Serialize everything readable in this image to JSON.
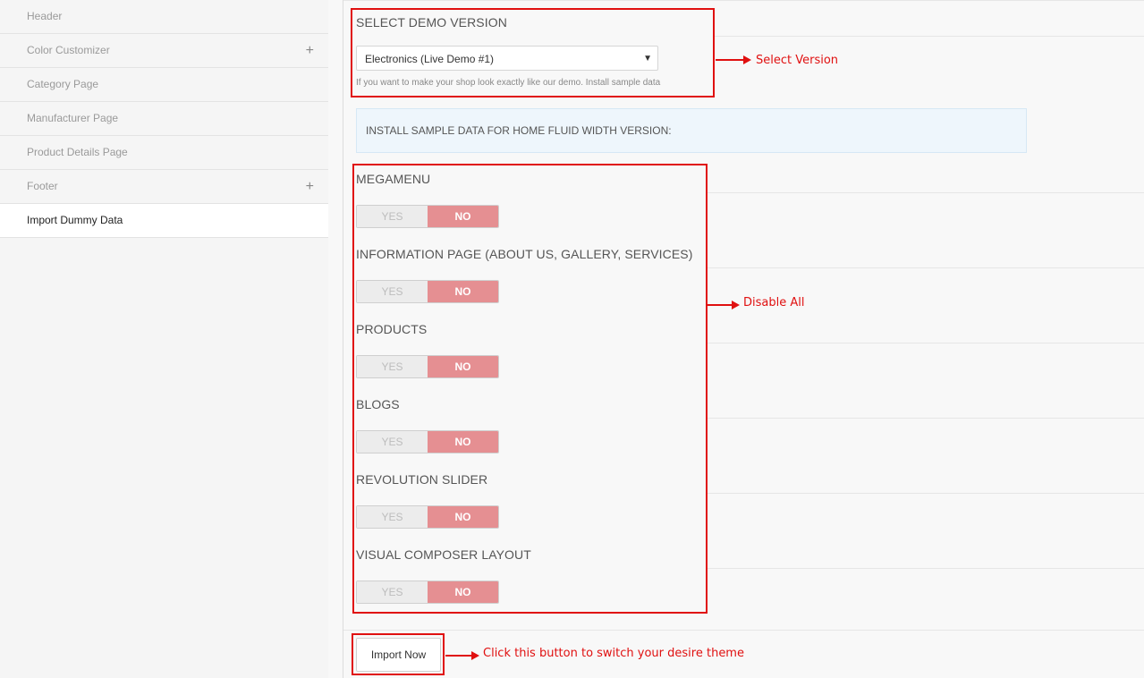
{
  "sidebar": {
    "items": [
      {
        "label": "Header",
        "expandable": false,
        "active": false
      },
      {
        "label": "Color Customizer",
        "expandable": true,
        "active": false
      },
      {
        "label": "Category Page",
        "expandable": false,
        "active": false
      },
      {
        "label": "Manufacturer Page",
        "expandable": false,
        "active": false
      },
      {
        "label": "Product Details Page",
        "expandable": false,
        "active": false
      },
      {
        "label": "Footer",
        "expandable": true,
        "active": false
      },
      {
        "label": "Import Dummy Data",
        "expandable": false,
        "active": true
      }
    ],
    "plus_icon": "+"
  },
  "demo": {
    "heading": "SELECT DEMO VERSION",
    "selected": "Electronics (Live Demo #1)",
    "caret_icon": "▼",
    "help": "If you want to make your shop look exactly like our demo. Install sample data"
  },
  "info": {
    "text": "INSTALL SAMPLE DATA FOR HOME FLUID WIDTH VERSION:"
  },
  "options": [
    {
      "label": "MEGAMENU",
      "yes": "YES",
      "no": "NO",
      "value": "NO"
    },
    {
      "label": "INFORMATION PAGE (ABOUT US, GALLERY, SERVICES)",
      "yes": "YES",
      "no": "NO",
      "value": "NO"
    },
    {
      "label": "PRODUCTS",
      "yes": "YES",
      "no": "NO",
      "value": "NO"
    },
    {
      "label": "BLOGS",
      "yes": "YES",
      "no": "NO",
      "value": "NO"
    },
    {
      "label": "REVOLUTION SLIDER",
      "yes": "YES",
      "no": "NO",
      "value": "NO"
    },
    {
      "label": "VISUAL COMPOSER LAYOUT",
      "yes": "YES",
      "no": "NO",
      "value": "NO"
    }
  ],
  "import_button": "Import Now",
  "annotations": {
    "select_version": "Select Version",
    "disable_all": "Disable All",
    "click_button": "Click this button to switch your desire theme"
  },
  "colors": {
    "annotation_red": "#e01010",
    "toggle_no": "#e58f92",
    "info_bg": "#eef6fc"
  }
}
